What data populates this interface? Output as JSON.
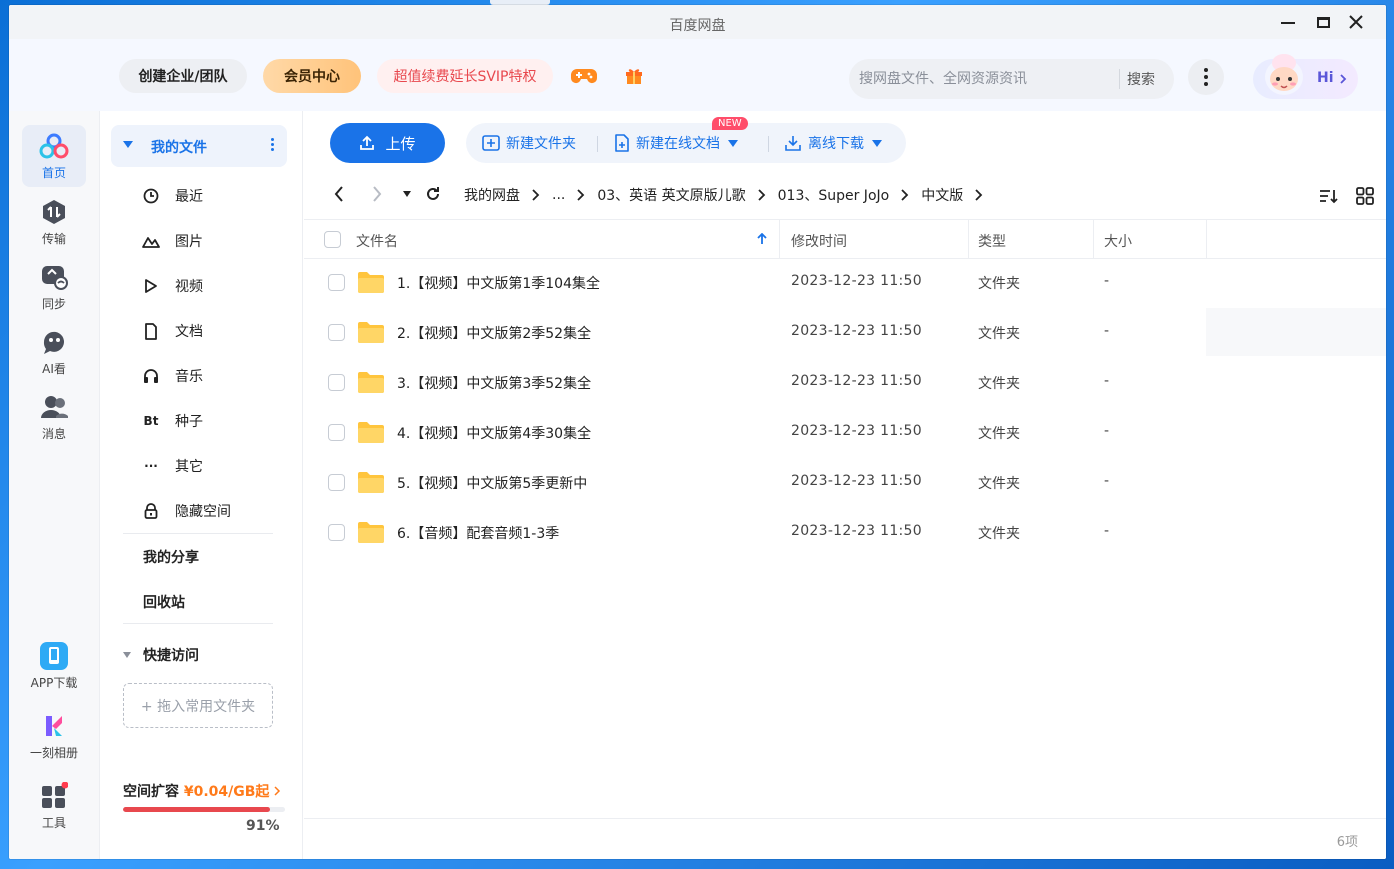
{
  "window": {
    "title": "百度网盘"
  },
  "header": {
    "team_label": "创建企业/团队",
    "vip_label": "会员中心",
    "svip_label": "超值续费延长SVIP特权",
    "search_placeholder": "搜网盘文件、全网资源资讯",
    "search_button": "搜索",
    "hi_label": "Hi"
  },
  "leftnav": {
    "items": [
      {
        "label": "首页",
        "icon": "home-cloud-icon"
      },
      {
        "label": "传输",
        "icon": "transfer-icon"
      },
      {
        "label": "同步",
        "icon": "sync-icon"
      },
      {
        "label": "AI看",
        "icon": "ai-view-icon"
      },
      {
        "label": "消息",
        "icon": "message-icon"
      },
      {
        "label": "APP下载",
        "icon": "phone-icon"
      },
      {
        "label": "一刻相册",
        "icon": "album-icon"
      },
      {
        "label": "工具",
        "icon": "tools-icon"
      }
    ]
  },
  "sidebar": {
    "my_files": "我的文件",
    "items": [
      {
        "label": "最近",
        "icon": "clock-icon"
      },
      {
        "label": "图片",
        "icon": "image-icon"
      },
      {
        "label": "视频",
        "icon": "play-icon"
      },
      {
        "label": "文档",
        "icon": "doc-icon"
      },
      {
        "label": "音乐",
        "icon": "headphone-icon"
      },
      {
        "label": "种子",
        "icon": "bt-icon",
        "glyph": "Bt"
      },
      {
        "label": "其它",
        "icon": "more-dots-icon",
        "glyph": "···"
      },
      {
        "label": "隐藏空间",
        "icon": "lock-icon"
      }
    ],
    "my_share": "我的分享",
    "recycle": "回收站",
    "quick_access": "快捷访问",
    "drop_hint": "+ 拖入常用文件夹",
    "quota_label": "空间扩容",
    "quota_price": "¥0.04/GB起",
    "quota_percent": "91%",
    "quota_fraction": 0.91
  },
  "toolbar": {
    "upload": "上传",
    "new_folder": "新建文件夹",
    "new_online_doc": "新建在线文档",
    "new_badge": "NEW",
    "offline_download": "离线下载"
  },
  "breadcrumb": [
    "我的网盘",
    "...",
    "03、英语 英文原版儿歌",
    "013、Super JoJo",
    "中文版"
  ],
  "table": {
    "headers": {
      "name": "文件名",
      "time": "修改时间",
      "type": "类型",
      "size": "大小"
    },
    "rows": [
      {
        "name": "1.【视频】中文版第1季104集全",
        "time": "2023-12-23 11:50",
        "type": "文件夹",
        "size": "-"
      },
      {
        "name": "2.【视频】中文版第2季52集全",
        "time": "2023-12-23 11:50",
        "type": "文件夹",
        "size": "-"
      },
      {
        "name": "3.【视频】中文版第3季52集全",
        "time": "2023-12-23 11:50",
        "type": "文件夹",
        "size": "-"
      },
      {
        "name": "4.【视频】中文版第4季30集全",
        "time": "2023-12-23 11:50",
        "type": "文件夹",
        "size": "-"
      },
      {
        "name": "5.【视频】中文版第5季更新中",
        "time": "2023-12-23 11:50",
        "type": "文件夹",
        "size": "-"
      },
      {
        "name": "6.【音频】配套音频1-3季",
        "time": "2023-12-23 11:50",
        "type": "文件夹",
        "size": "-"
      }
    ]
  },
  "footer": {
    "count": "6项"
  },
  "colors": {
    "accent": "#1a73e8",
    "danger": "#e8484e",
    "price": "#ff7a1a",
    "folder": "#ffc53d"
  }
}
